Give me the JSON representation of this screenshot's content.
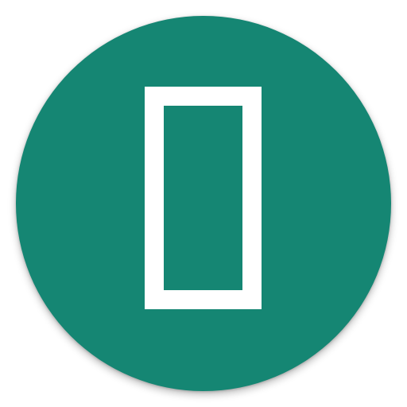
{
  "icon": {
    "name": "app-launcher-icon",
    "background_color": "#158673",
    "glyph_color": "#ffffff",
    "glyph": "missing-glyph-box-icon"
  }
}
